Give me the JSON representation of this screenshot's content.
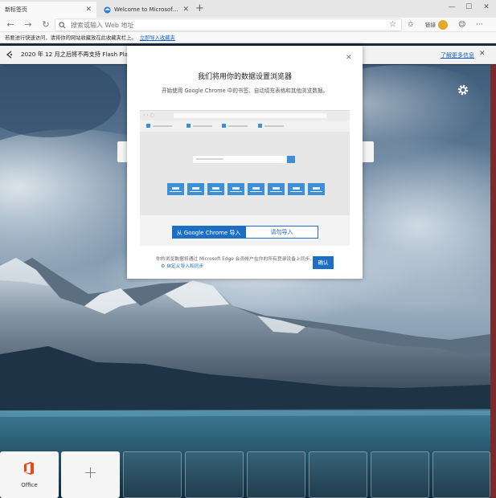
{
  "tabs": [
    {
      "title": "新标签页",
      "active": true
    },
    {
      "title": "Welcome to Microsoft Edge Ca",
      "active": false
    }
  ],
  "toolbar": {
    "address_placeholder": "搜索或输入 Web 地址",
    "profile_label": "链接"
  },
  "favorites_bar": {
    "message": "若要进行快速访问，请将你的网站收藏放在此收藏夹栏上。",
    "import_link": "立即导入收藏夹"
  },
  "infobar": {
    "message": "2020 年 12 月之后将不再支持 Flash Player。",
    "learn_more": "了解更多信息"
  },
  "dialog": {
    "title": "我们将用你的数据设置浏览器",
    "subtitle": "开始使用 Google Chrome 中的书签、自动填充表格和其他浏览数据。",
    "import_chrome_button": "从 Google Chrome 导入",
    "manual_import_button": "请勿导入",
    "footer_text": "你的浏览数据将通过 Microsoft Edge 会员帐户在你的所有登录设备上同步。",
    "footer_link": "自定义导入和同步",
    "confirm_button": "确认"
  },
  "tiles": [
    {
      "label": "Office"
    }
  ],
  "colors": {
    "accent": "#1d6fc6",
    "office": "#e64a19"
  }
}
